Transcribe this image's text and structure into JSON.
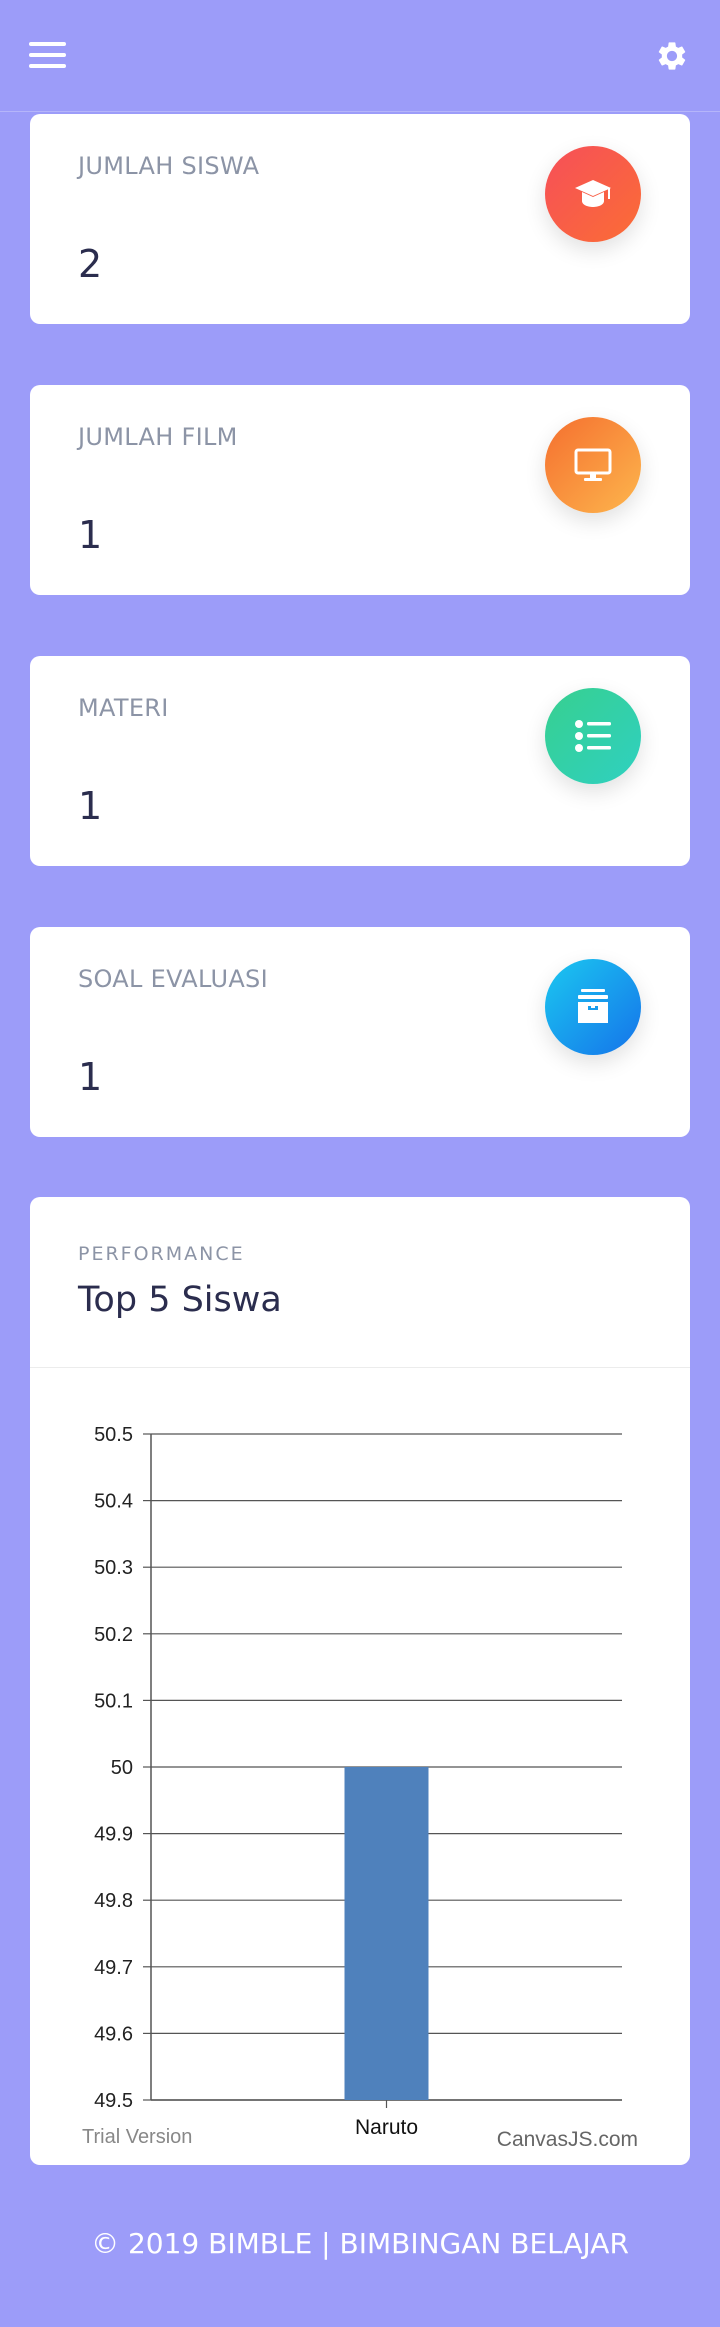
{
  "colors": {
    "background": "#9c9cf9",
    "card": "#ffffff",
    "bar": "#4f81bc"
  },
  "header": {
    "menu_icon": "hamburger-menu-icon",
    "settings_icon": "gear-icon"
  },
  "stats": [
    {
      "title": "JUMLAH SISWA",
      "value": "2",
      "icon": "graduation-cap-icon",
      "gradient": [
        "#f64f59",
        "#fb6d35"
      ]
    },
    {
      "title": "JUMLAH FILM",
      "value": "1",
      "icon": "monitor-icon",
      "gradient": [
        "#f56f2f",
        "#fdb64d"
      ]
    },
    {
      "title": "MATERI",
      "value": "1",
      "icon": "list-icon",
      "gradient": [
        "#37cf8f",
        "#2fd1c1"
      ]
    },
    {
      "title": "SOAL EVALUASI",
      "value": "1",
      "icon": "archive-icon",
      "gradient": [
        "#1bc8f0",
        "#1573ea"
      ]
    }
  ],
  "performance": {
    "subtitle": "PERFORMANCE",
    "title": "Top 5 Siswa"
  },
  "chart_data": {
    "type": "bar",
    "categories": [
      "Naruto"
    ],
    "values": [
      50
    ],
    "ylim": [
      49.5,
      50.5
    ],
    "yticks": [
      "50.5",
      "50.4",
      "50.3",
      "50.2",
      "50.1",
      "50",
      "49.9",
      "49.8",
      "49.7",
      "49.6",
      "49.5"
    ],
    "grid": true,
    "watermark_left": "Trial Version",
    "watermark_right": "CanvasJS.com"
  },
  "footer": {
    "text": "© 2019 BIMBLE | BIMBINGAN BELAJAR"
  }
}
